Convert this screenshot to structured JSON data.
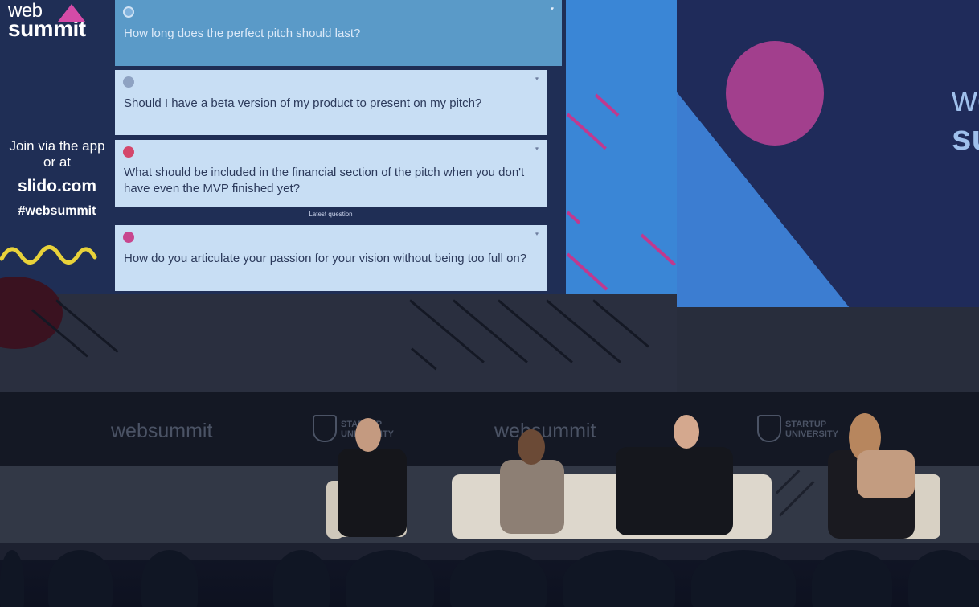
{
  "screen": {
    "brand_web": "web",
    "brand_summit": "summit",
    "join_line1": "Join via the app",
    "join_line2": "or at",
    "join_site": "slido.com",
    "join_hashtag": "#websummit",
    "latest_label": "Latest question",
    "questions": [
      {
        "text": "How long does the perfect pitch should last?"
      },
      {
        "text": "Should I have a beta version of my product to present on my pitch?"
      },
      {
        "text": "What should be included in the financial section of the pitch when you don't have even the MVP finished yet?"
      },
      {
        "text": "How do you articulate your passion for your vision without being too full on?"
      }
    ]
  },
  "right_screen": {
    "side_line1": "we",
    "side_line2": "su"
  },
  "banner": {
    "items": [
      "websummit",
      "STARTUP UNIVERSITY",
      "websummit",
      "STARTUP UNIVERSITY"
    ]
  },
  "colors": {
    "screen_bg": "#1f2e55",
    "card_bg": "#c8def4",
    "accent_pink": "#c0398f",
    "accent_blue": "#3a86d6"
  }
}
